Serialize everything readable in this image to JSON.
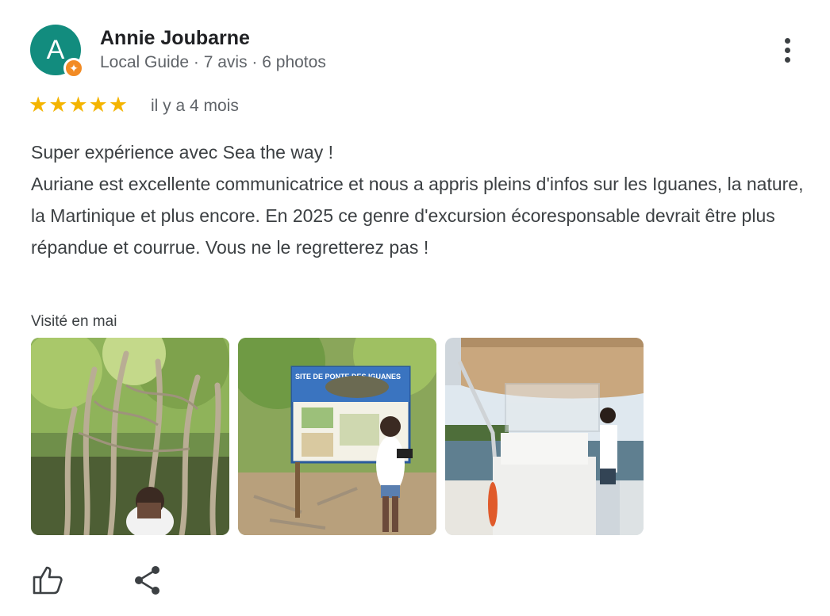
{
  "author": {
    "name": "Annie Joubarne",
    "avatar_letter": "A",
    "meta": "Local Guide · 7 avis · 6 photos",
    "avatar_color": "#128c7e",
    "badge_color": "#f28b24"
  },
  "rating": {
    "stars": 5,
    "max": 5,
    "time": "il y a 4 mois",
    "star_color": "#f4b400"
  },
  "review": {
    "lines": [
      "Super expérience avec Sea the way !",
      "Auriane est excellente communicatrice et nous a appris pleins d'infos sur les Iguanes, la nature, la Martinique et plus encore. En 2025 ce genre d'excursion écoresponsable devrait être plus répandue et courrue. Vous ne le regretterez pas !"
    ]
  },
  "visited": "Visité en mai",
  "photos": [
    {
      "name": "photo-banyan-tree"
    },
    {
      "name": "photo-iguana-sign"
    },
    {
      "name": "photo-boat"
    }
  ],
  "photo_sign_text": "SITE DE PONTE DES IGUANES",
  "icons": {
    "more": "more-vert-icon",
    "like": "thumbs-up-icon",
    "share": "share-icon",
    "star": "star-icon"
  }
}
